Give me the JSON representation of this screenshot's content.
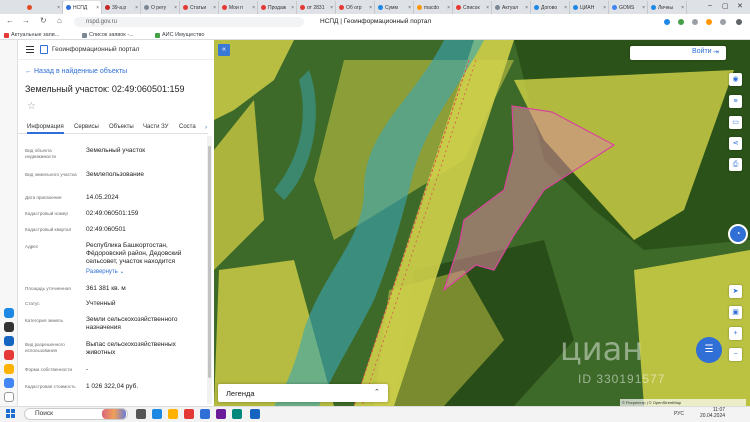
{
  "browser": {
    "tabs": [
      {
        "label": "",
        "color": "#e34c26"
      },
      {
        "label": "НСПД",
        "color": "#2f6fd6"
      },
      {
        "label": "39-а.р",
        "color": "#c62828"
      },
      {
        "label": "О регу",
        "color": "#7b8794"
      },
      {
        "label": "Статьи",
        "color": "#e53935"
      },
      {
        "label": "Мои п",
        "color": "#e53935"
      },
      {
        "label": "Продаж",
        "color": "#e53935"
      },
      {
        "label": "от 2831",
        "color": "#e53935"
      },
      {
        "label": "Об огр",
        "color": "#e53935"
      },
      {
        "label": "Сумм",
        "color": "#1e88e5"
      },
      {
        "label": "macdo",
        "color": "#ff9800"
      },
      {
        "label": "Список",
        "color": "#e53935"
      },
      {
        "label": "Актуал",
        "color": "#7b8794"
      },
      {
        "label": "Догово",
        "color": "#1e88e5"
      },
      {
        "label": "ЦИАН",
        "color": "#1e88e5"
      },
      {
        "label": "GOMS",
        "color": "#4285f4"
      },
      {
        "label": "Личны",
        "color": "#1e88e5"
      }
    ],
    "active_tab": 1,
    "address": "nspd.gov.ru",
    "page_title": "НСПД | Геоинформационный портал",
    "bookmarks": [
      {
        "label": "Актуальные запи...",
        "color": "#e53935"
      },
      {
        "label": "Список заявок -...",
        "color": "#7b8794"
      },
      {
        "label": "АИС Имущество",
        "color": "#43a047"
      }
    ]
  },
  "sidebar": {
    "brand": "Геоинформационный портал",
    "back_link": "Назад в найденные объекты",
    "title": "Земельный участок: 02:49:060501:159",
    "tabs": [
      "Информация",
      "Сервисы",
      "Объекты",
      "Части ЗУ",
      "Соста"
    ],
    "tab_arrow": "›",
    "properties": [
      {
        "label": "Вид объекта недвижимости",
        "value": "Земельный участок"
      },
      {
        "label": "Вид земельного участка",
        "value": "Землепользование"
      },
      {
        "label": "Дата присвоения",
        "value": "14.05.2024"
      },
      {
        "label": "Кадастровый номер",
        "value": "02:49:060501:159"
      },
      {
        "label": "Кадастровый квартал",
        "value": "02:49:060501"
      },
      {
        "label": "Адрес",
        "value": "Республика Башкортостан, Фёдоровский район, Дедовский сельсовет, участок находится"
      },
      {
        "label": "Площадь уточненная",
        "value": "361 381 кв. м"
      },
      {
        "label": "Статус",
        "value": "Учтенный"
      },
      {
        "label": "Категория земель",
        "value": "Земли сельскохозяйственного назначения"
      },
      {
        "label": "Вид разрешенного использования",
        "value": "Выпас сельскохозяйственных животных"
      },
      {
        "label": "Форма собственности",
        "value": "-"
      },
      {
        "label": "Кадастровая стоимость",
        "value": "1 026 322,04 руб."
      }
    ],
    "expand_link": "Развернуть"
  },
  "map": {
    "login_label": "Войти",
    "legend_label": "Легенда",
    "watermark": "циан",
    "watermark_id": "ID 330191577",
    "attribution": "© Росреестр | © OpenStreetMap",
    "colors": {
      "field": "#c9cc45",
      "forest": "#2f5a1e",
      "river": "#3aa6b6",
      "parcel": "#d98a9a",
      "accent": "#2f6fd6"
    }
  },
  "taskbar": {
    "search_placeholder": "Поиск",
    "tray_lang": "РУС",
    "time": "11:07",
    "date": "20.04.2024"
  }
}
